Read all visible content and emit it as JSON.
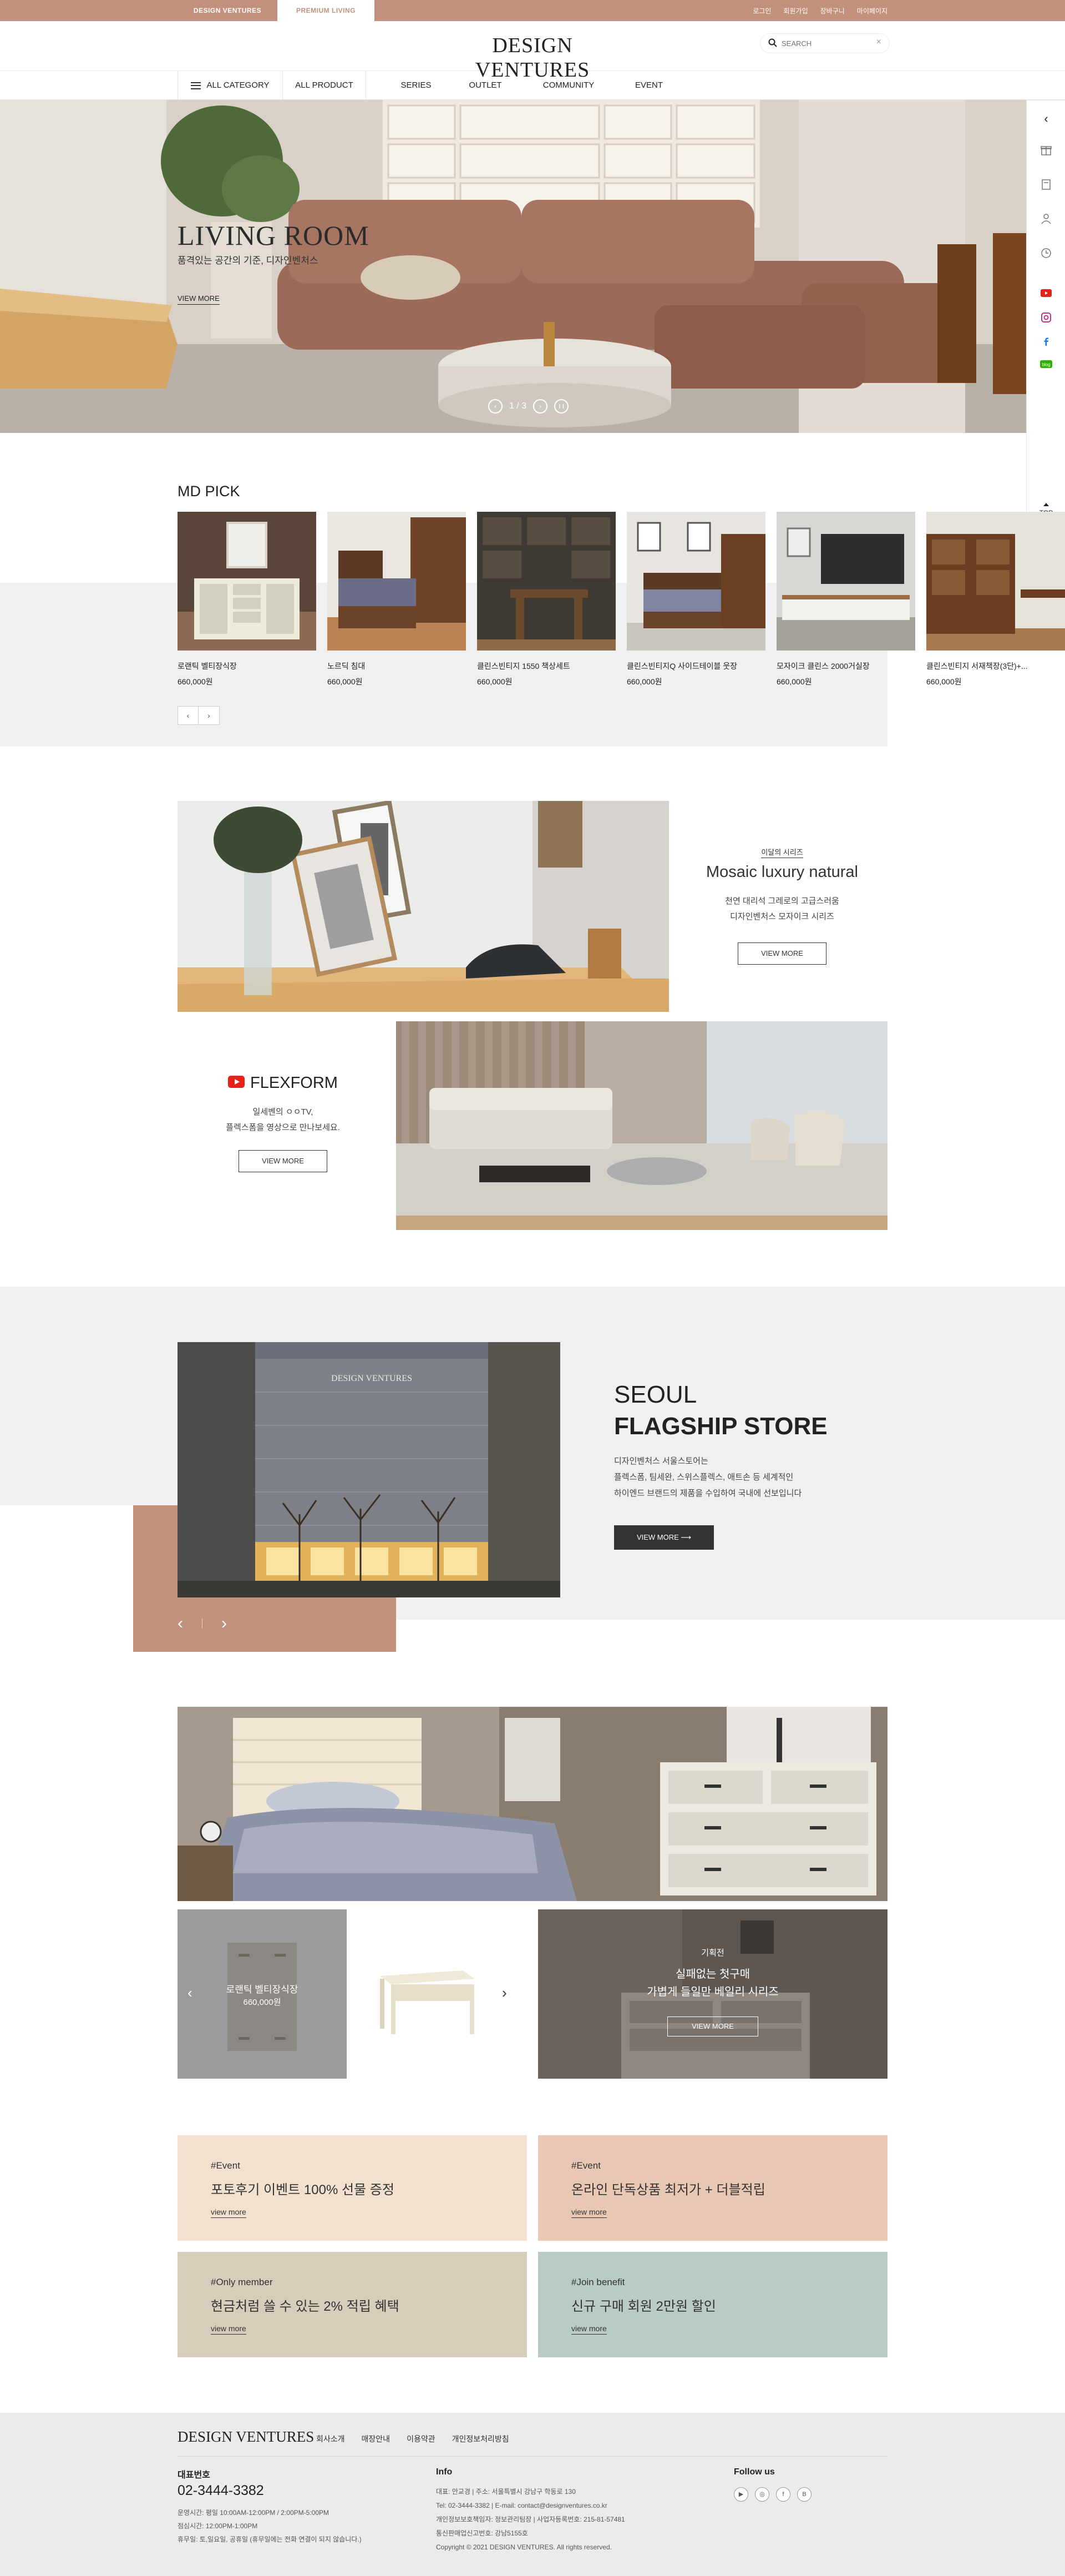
{
  "topbar": {
    "brand_tabs": [
      "DESIGN VENTURES",
      "PREMIUM LIVING"
    ],
    "util_links": [
      "로그인",
      "회원가입",
      "장바구니",
      "마이페이지"
    ]
  },
  "header": {
    "logo": "DESIGN VENTURES",
    "search_placeholder": "SEARCH",
    "search_clear": "×"
  },
  "gnb": {
    "all_category": "ALL CATEGORY",
    "all_product": "ALL PRODUCT",
    "items": [
      "SERIES",
      "OUTLET",
      "COMMUNITY",
      "EVENT"
    ]
  },
  "hero": {
    "title": "LIVING ROOM",
    "subtitle": "품격있는 공간의 기준, 디자인벤처스",
    "cta": "VIEW MORE",
    "pager": "1 / 3",
    "prev": "‹",
    "next": "›",
    "pause": "❙❙"
  },
  "quick": {
    "collapse": "‹",
    "top": "TOP"
  },
  "md_pick": {
    "title": "MD PICK",
    "items": [
      {
        "name": "로랜틱 벨티장식장",
        "price": "660,000원"
      },
      {
        "name": "노르딕 침대",
        "price": "660,000원"
      },
      {
        "name": "클린스빈티지 1550 책상세트",
        "price": "660,000원"
      },
      {
        "name": "클린스빈티지Q 사이드테이블 웃장",
        "price": "660,000원"
      },
      {
        "name": "모자이크 클린스 2000거실장",
        "price": "660,000원"
      },
      {
        "name": "클린스빈티지 서재책장(3단)+...",
        "price": "660,000원"
      }
    ],
    "prev": "‹",
    "next": "›"
  },
  "series": {
    "label": "이달의 시리즈",
    "title": "Mosaic luxury natural",
    "desc_lines": [
      "천연 대리석 그레로의 고급스러움",
      "디자인벤처스 모자이크 시리즈"
    ],
    "cta": "VIEW MORE"
  },
  "flexform": {
    "title": "FLEXFORM",
    "desc_lines": [
      "일세벤의 ㅇㅇTV,",
      "플렉스폼을 영상으로 만나보세요."
    ],
    "cta": "VIEW MORE"
  },
  "flagship": {
    "title1": "SEOUL",
    "title2": "FLAGSHIP STORE",
    "desc_lines": [
      "디자인벤처스 서울스토어는",
      "플렉스폼, 팀세완, 스위스플렉스, 애트손 등 세계적인",
      "하이엔드 브랜드의 제품을 수입하여 국내에 선보입니다"
    ],
    "cta": "VIEW MORE ⟶",
    "building_sign": "DESIGN VENTURES",
    "prev": "‹",
    "next": "›"
  },
  "product_slider": {
    "name": "로랜틱 벨티장식장",
    "price": "660,000원",
    "prev": "‹",
    "next": "›"
  },
  "plan": {
    "label": "기획전",
    "line1": "실패없는 첫구매",
    "line2": "가볍게 들일만 베일리 시리즈",
    "cta": "VIEW MORE"
  },
  "events": [
    {
      "tag": "#Event",
      "title": "포토후기 이벤트 100% 선물 증정",
      "link": "view more"
    },
    {
      "tag": "#Event",
      "title": "온라인 단독상품 최저가 + 더블적립",
      "link": "view more"
    },
    {
      "tag": "#Only member",
      "title": "현금처럼 쓸 수 있는 2% 적립 혜택",
      "link": "view more"
    },
    {
      "tag": "#Join benefit",
      "title": "신규 구매 회원 2만원 할인",
      "link": "view more"
    }
  ],
  "footer": {
    "logo": "DESIGN VENTURES",
    "links": [
      "회사소개",
      "매장안내",
      "이용약관",
      "개인정보처리방침"
    ],
    "rep_title": "대표번호",
    "phone": "02-3444-3382",
    "hours": [
      "운영시간: 평일 10:00AM-12:00PM / 2:00PM-5:00PM",
      "점심시간: 12:00PM-1:00PM",
      "휴무일: 토,일요일, 공휴일 (휴무일에는 전화 연결이 되지 않습니다.)"
    ],
    "info_title": "Info",
    "info": [
      "대표: 안교경  |  주소: 서울특별시 강남구 학동로 130",
      "Tel: 02-3444-3382  |  E-mail: contact@designventures.co.kr",
      "개인정보보호책임자: 정보관리팀장  |  사업자등록번호: 215-81-57481",
      "통신판매업신고번호: 강남5155호",
      "Copyright © 2021 DESIGN VENTURES. All rights reserved."
    ],
    "follow_title": "Follow us",
    "social": [
      "▶",
      "◎",
      "f",
      "B"
    ]
  }
}
